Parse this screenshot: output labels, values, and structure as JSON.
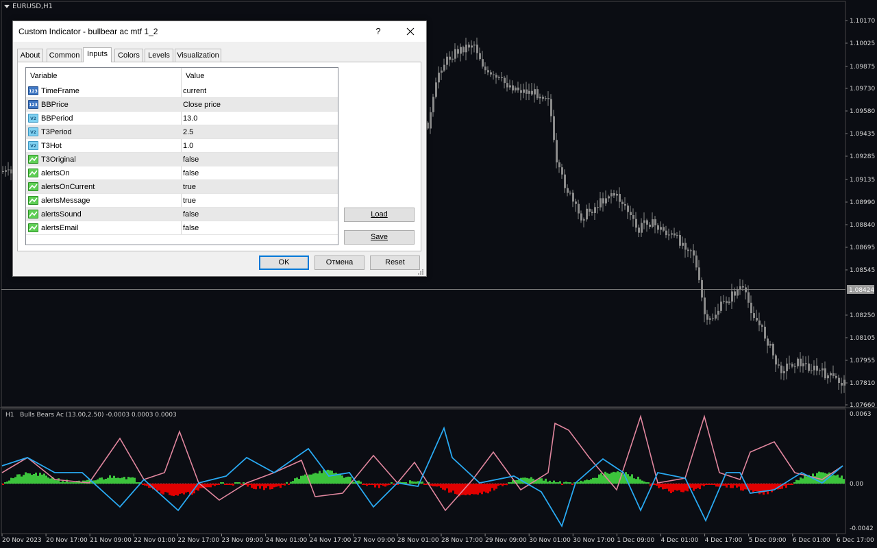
{
  "symbol": "EURUSD,H1",
  "subwindow_label": "H1   Bulls Bears Ac (13.00,2.50) -0.0003 0.0003 0.0003",
  "price_axis": [
    "1.10170",
    "1.10025",
    "1.09875",
    "1.09730",
    "1.09580",
    "1.09435",
    "1.09285",
    "1.09135",
    "1.08990",
    "1.08840",
    "1.08695",
    "1.08545",
    "1.08424",
    "1.08250",
    "1.08105",
    "1.07955",
    "1.07810",
    "1.07660"
  ],
  "current_price": "1.08424",
  "sub_axis": [
    "0.0063",
    "0.00",
    "-0.0042"
  ],
  "time_axis": [
    "20 Nov 2023",
    "20 Nov 17:00",
    "21 Nov 09:00",
    "22 Nov 01:00",
    "22 Nov 17:00",
    "23 Nov 09:00",
    "24 Nov 01:00",
    "24 Nov 17:00",
    "27 Nov 09:00",
    "28 Nov 01:00",
    "28 Nov 17:00",
    "29 Nov 09:00",
    "30 Nov 01:00",
    "30 Nov 17:00",
    "1 Dec 09:00",
    "4 Dec 01:00",
    "4 Dec 17:00",
    "5 Dec 09:00",
    "6 Dec 01:00",
    "6 Dec 17:00"
  ],
  "colors": {
    "background": "#0b0d13",
    "candle": "#8a8a8a",
    "pink": "#e0869e",
    "blue": "#29a9f2",
    "green": "#3cc33c",
    "red": "#e00000"
  },
  "dialog": {
    "title": "Custom Indicator - bullbear ac mtf 1_2",
    "help": "?",
    "tabs": [
      "About",
      "Common",
      "Inputs",
      "Colors",
      "Levels",
      "Visualization"
    ],
    "active_tab": "Inputs",
    "headers": {
      "variable": "Variable",
      "value": "Value"
    },
    "params": [
      {
        "name": "TimeFrame",
        "value": "current",
        "icon": "123"
      },
      {
        "name": "BBPrice",
        "value": "Close price",
        "icon": "123"
      },
      {
        "name": "BBPeriod",
        "value": "13.0",
        "icon": "V2"
      },
      {
        "name": "T3Period",
        "value": "2.5",
        "icon": "V2"
      },
      {
        "name": "T3Hot",
        "value": "1.0",
        "icon": "V2"
      },
      {
        "name": "T3Original",
        "value": "false",
        "icon": "bool"
      },
      {
        "name": "alertsOn",
        "value": "false",
        "icon": "bool"
      },
      {
        "name": "alertsOnCurrent",
        "value": "true",
        "icon": "bool"
      },
      {
        "name": "alertsMessage",
        "value": "true",
        "icon": "bool"
      },
      {
        "name": "alertsSound",
        "value": "false",
        "icon": "bool"
      },
      {
        "name": "alertsEmail",
        "value": "false",
        "icon": "bool"
      }
    ],
    "load_label": "Load",
    "save_label": "Save",
    "ok_label": "OK",
    "cancel_label": "Отмена",
    "reset_label": "Reset"
  }
}
